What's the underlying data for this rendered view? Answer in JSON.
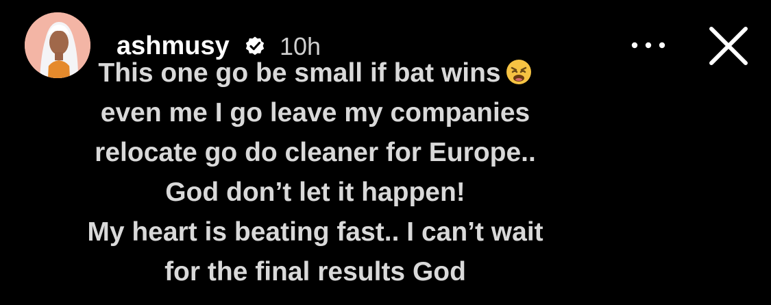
{
  "story": {
    "username": "ashmusy",
    "verified": true,
    "timestamp": "10h",
    "header_icons": {
      "verified": "verified-badge-icon",
      "more": "more-options-icon",
      "close": "close-icon"
    },
    "caption_lines": [
      "This one go be small if bat wins",
      "even me I go leave my companies",
      "relocate go do cleaner for Europe..",
      "God don’t let it happen!",
      "My heart is beating fast.. I can’t wait",
      "for the final results God"
    ],
    "caption_emoji": "weary-face-emoji",
    "colors": {
      "background": "#000000",
      "text": "#d9d9d9",
      "username": "#ffffff",
      "timestamp": "#cfcfcf"
    }
  }
}
